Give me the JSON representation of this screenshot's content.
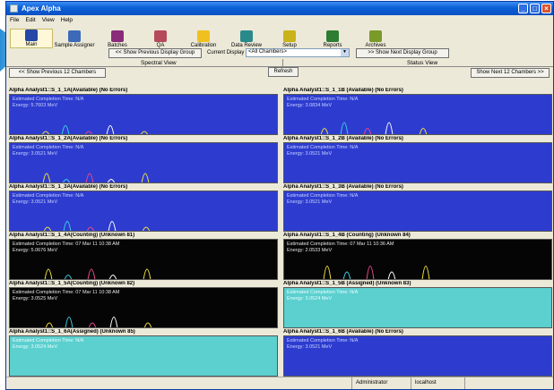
{
  "window": {
    "title": "Apex Alpha"
  },
  "menu": [
    "File",
    "Edit",
    "View",
    "Help"
  ],
  "toolbar": [
    {
      "label": "Main",
      "icon": "main-icon",
      "color": "#2447a8",
      "selected": true
    },
    {
      "label": "Sample Assigner",
      "icon": "sample-assigner-icon",
      "color": "#3d6ab8"
    },
    {
      "label": "Batches",
      "icon": "batches-icon",
      "color": "#8a2b7a"
    },
    {
      "label": "QA",
      "icon": "qa-icon",
      "color": "#b54a5a"
    },
    {
      "label": "Calibration",
      "icon": "calibration-icon",
      "color": "#f0c020"
    },
    {
      "label": "Data Review",
      "icon": "data-review-icon",
      "color": "#2a8a8a"
    },
    {
      "label": "Setup",
      "icon": "setup-icon",
      "color": "#c9b318"
    },
    {
      "label": "Reports",
      "icon": "reports-icon",
      "color": "#2e7d32"
    },
    {
      "label": "Archives",
      "icon": "archives-icon",
      "color": "#7a9a2a"
    }
  ],
  "group": {
    "prev": "<< Show Previous Display Group",
    "label": "Current Display Group:",
    "current": "<All Chambers>",
    "next": ">> Show Next Display Group"
  },
  "views": {
    "spectral": "Spectral View",
    "status": "Status View"
  },
  "nav": {
    "prev": "<< Show Previous 12 Chambers",
    "refresh": "Refresh",
    "next": "Show Next 12 Chambers >>"
  },
  "panels": [
    {
      "title": "Alpha Analyst1::S_1_1A(Available) (No Errors)",
      "state": "available",
      "line1": "Estimated Completion Time: N/A",
      "line2": "Energy: 5.7603 MeV",
      "has_spectrum": true
    },
    {
      "title": "Alpha Analyst1::S_1_1B (Available) (No Errors)",
      "state": "available",
      "line1": "Estimated Completion Time: N/A",
      "line2": "Energy: 3.0834 MeV",
      "has_spectrum": true
    },
    {
      "title": "Alpha Analyst1::S_1_2A(Available) (No Errors)",
      "state": "available",
      "line1": "Estimated Completion Time: N/A",
      "line2": "Energy: 3.0521 MeV",
      "has_spectrum": true
    },
    {
      "title": "Alpha Analyst1::S_1_2B (Available) (No Errors)",
      "state": "available",
      "line1": "Estimated Completion Time: N/A",
      "line2": "Energy: 3.0521 MeV",
      "has_spectrum": false
    },
    {
      "title": "Alpha Analyst1::S_1_3A(Available) (No Errors)",
      "state": "available",
      "line1": "Estimated Completion Time: N/A",
      "line2": "Energy: 3.0521 MeV",
      "has_spectrum": true
    },
    {
      "title": "Alpha Analyst1::S_1_3B (Available) (No Errors)",
      "state": "available",
      "line1": "Estimated Completion Time: N/A",
      "line2": "Energy: 3.0521 MeV",
      "has_spectrum": false
    },
    {
      "title": "Alpha Analyst1::S_1_4A(Counting) (Unknown 81)",
      "state": "counting",
      "line1": "Estimated Completion Time: 07 Mar 11 10:38 AM",
      "line2": "Energy: 5.0676 MeV",
      "has_spectrum": true
    },
    {
      "title": "Alpha Analyst1::S_1_4B (Counting) (Unknown 84)",
      "state": "counting",
      "line1": "Estimated Completion Time: 07 Mar 11 10:36 AM",
      "line2": "Energy: 2.0533 MeV",
      "has_spectrum": true
    },
    {
      "title": "Alpha Analyst1::S_1_5A(Counting) (Unknown 82)",
      "state": "counting",
      "line1": "Estimated Completion Time: 07 Mar 11 10:38 AM",
      "line2": "Energy: 3.0525 MeV",
      "has_spectrum": true
    },
    {
      "title": "Alpha Analyst1::S_1_5B (Assigned) (Unknown 83)",
      "state": "assigned",
      "line1": "Estimated Completion Time: N/A",
      "line2": "Energy: 3.0524 MeV",
      "has_spectrum": false
    },
    {
      "title": "Alpha Analyst1::S_1_6A(Assigned) (Unknown 85)",
      "state": "assigned",
      "line1": "Estimated Completion Time: N/A",
      "line2": "Energy: 3.0524 MeV",
      "has_spectrum": false
    },
    {
      "title": "Alpha Analyst1::S_1_6B (Available) (No Errors)",
      "state": "available",
      "line1": "Estimated Completion Time: N/A",
      "line2": "Energy: 3.0521 MeV",
      "has_spectrum": false
    }
  ],
  "statusbar": {
    "user": "Administrator",
    "host": "localhost"
  },
  "colors": {
    "available": "#2d3ccf",
    "counting": "#050505",
    "assigned": "#5ccfcf",
    "peaks": [
      "#f0e040",
      "#3ad0e0",
      "#e84a8a",
      "#ffffff"
    ]
  }
}
